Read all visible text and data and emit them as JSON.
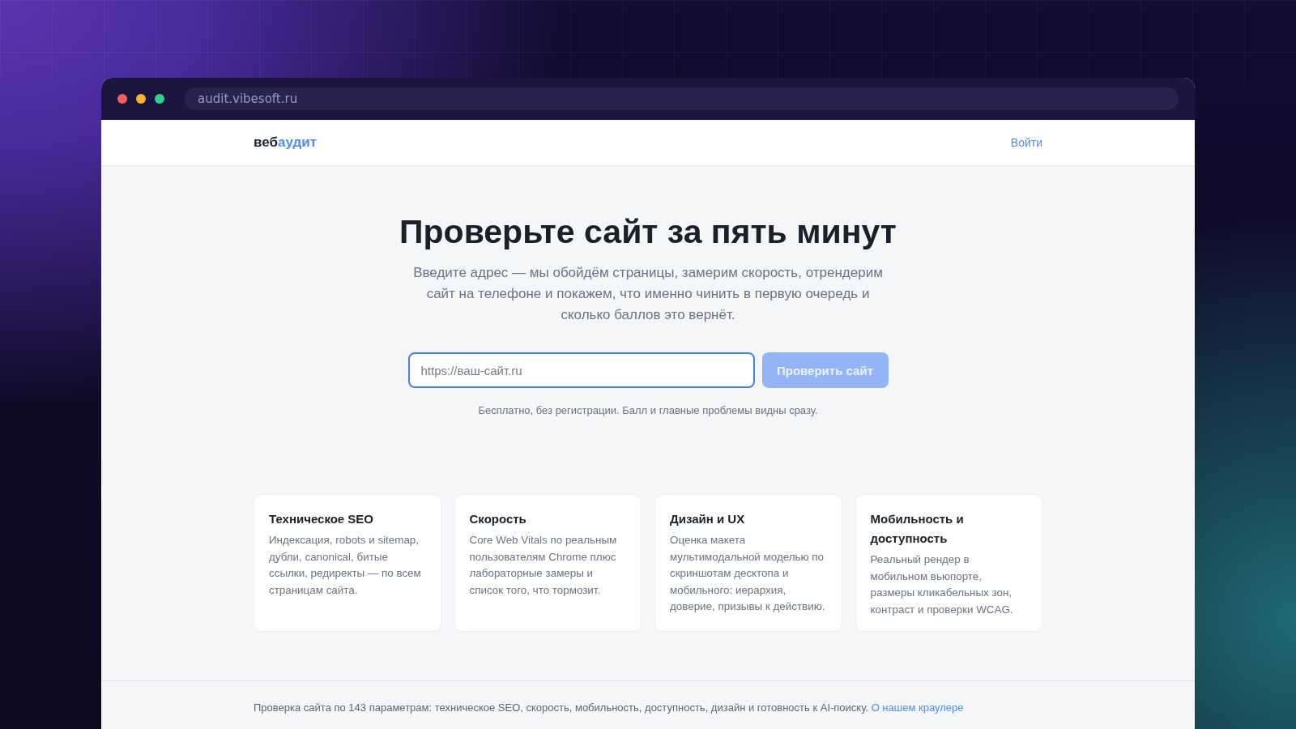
{
  "browser": {
    "address": "audit.vibesoft.ru"
  },
  "header": {
    "logo": [
      "веб",
      "аудит"
    ],
    "login": "Войти"
  },
  "hero": {
    "title": "Проверьте сайт за пять минут",
    "subtitle": "Введите адрес — мы обойдём страницы, замерим скорость, отрендерим сайт на телефоне и покажем, что именно чинить в первую очередь и сколько баллов это вернёт.",
    "url_field": {
      "placeholder": "https://ваш-сайт.ru",
      "focused": true
    },
    "submit": {
      "label": "Проверить сайт",
      "disabled": true
    },
    "note": "Бесплатно, без регистрации. Балл и главные проблемы видны сразу."
  },
  "features": [
    {
      "title": "Техническое SEO",
      "text": "Индексация, robots и sitemap, дубли, canonical, битые ссылки, редиректы — по всем страницам сайта."
    },
    {
      "title": "Скорость",
      "text": "Core Web Vitals по реальным пользователям Chrome плюс лабораторные замеры и список того, что тормозит."
    },
    {
      "title": "Дизайн и UX",
      "text": "Оценка макета мультимодальной моделью по скриншотам десктопа и мобильного: иерархия, доверие, призывы к действию."
    },
    {
      "title": "Мобильность и доступность",
      "text": "Реальный рендер в мобильном вьюпорте, размеры кликабельных зон, контраст и проверки WCAG."
    }
  ],
  "footer": {
    "text": "Проверка сайта по 143 параметрам: техническое SEO, скорость, мобильность, доступность, дизайн и готовность к AI-поиску.",
    "link": "О нашем краулере"
  }
}
